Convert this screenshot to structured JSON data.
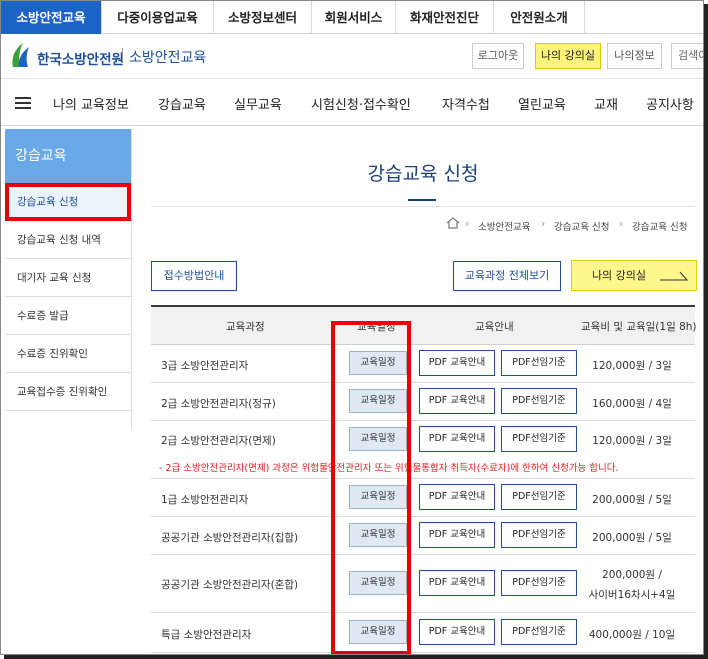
{
  "top_nav": [
    "소방안전교육",
    "다중이용업교육",
    "소방정보센터",
    "회원서비스",
    "화재안전진단",
    "안전원소개"
  ],
  "header": {
    "logo_text": "한국소방안전원",
    "logo_sub": "소방안전교육",
    "logout": "로그아웃",
    "my_classroom": "나의 강의실",
    "my_info": "나의정보",
    "search": "검색어"
  },
  "main_menu": [
    "나의 교육정보",
    "강습교육",
    "실무교육",
    "시험신청·접수확인",
    "자격수첩",
    "열린교육",
    "교재",
    "공지사항"
  ],
  "sidebar": {
    "title": "강습교육",
    "items": [
      "강습교육 신청",
      "강습교육 신청 내역",
      "대기자 교육 신청",
      "수료증 발급",
      "수료증 진위확인",
      "교육접수증 진위확인"
    ]
  },
  "page": {
    "title": "강습교육 신청",
    "breadcrumb": [
      "소방안전교육",
      "강습교육 신청",
      "강습교육 신청"
    ],
    "btn_guide": "접수방법안내",
    "btn_all_courses": "교육과정 전체보기",
    "btn_my_classroom": "나의 강의실"
  },
  "table": {
    "headers": [
      "교육과정",
      "교육일정",
      "교육안내",
      "교육비 및 교육일(1일 8h)"
    ],
    "schedule_label": "교육일정",
    "pdf_guide_label": "PDF 교육안내",
    "pdf_criteria_label": "PDF선임기준",
    "notice": "- 2급 소방안전관리자(면제) 과정은 위험물안전관리자 또는 위험물통합자 취득자(수료자)에 한하여 신청가능 합니다.",
    "rows": [
      {
        "name": "3급 소방안전관리자",
        "fee": "120,000원 / 3일"
      },
      {
        "name": "2급 소방안전관리자(정규)",
        "fee": "160,000원 / 4일"
      },
      {
        "name": "2급 소방안전관리자(면제)",
        "fee": "120,000원 / 3일"
      },
      {
        "name": "1급 소방안전관리자",
        "fee": "200,000원 / 5일"
      },
      {
        "name": "공공기관 소방안전관리자(집합)",
        "fee": "200,000원 / 5일"
      },
      {
        "name": "공공기관 소방안전관리자(혼합)",
        "fee": "200,000원 /",
        "fee2": "사이버16차시+4일"
      },
      {
        "name": "특급 소방안전관리자",
        "fee": "400,000원 / 10일"
      }
    ]
  }
}
